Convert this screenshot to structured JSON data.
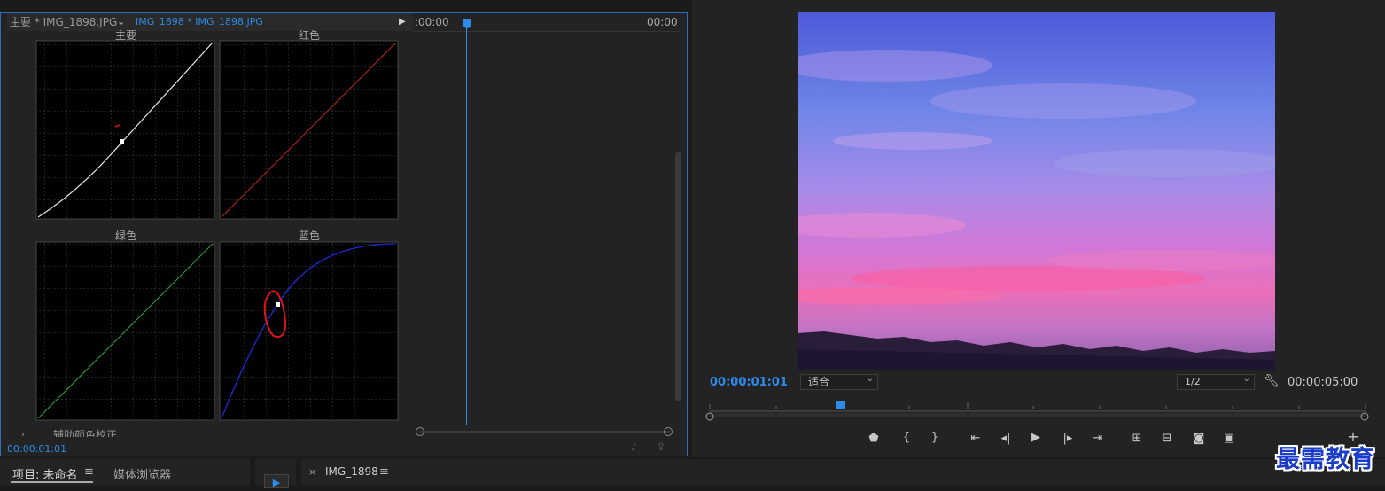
{
  "effect_controls": {
    "tab_master": "主要 * IMG_1898.JPG",
    "tab_clip": "IMG_1898 * IMG_1898.JPG",
    "timecode_start": ":00:00",
    "timecode_end": "00:00",
    "current_time": "00:00:01:01",
    "secondary_section": "辅助颜色校正",
    "curves": {
      "master": "主要",
      "red": "红色",
      "green": "绿色",
      "blue": "蓝色"
    }
  },
  "program_monitor": {
    "current_time": "00:00:01:01",
    "fit_label": "适合",
    "resolution": "1/2",
    "duration": "00:00:05:00"
  },
  "bottom": {
    "project_tab": "项目: 未命名",
    "media_browser_tab": "媒体浏览器",
    "sequence_tab": "IMG_1898"
  },
  "watermark": "最需教育",
  "colors": {
    "accent": "#2d8ceb",
    "red_curve": "#c0241c",
    "green_curve": "#2fa82f",
    "blue_curve": "#1a2bd6",
    "annotation": "#e0121b"
  },
  "icons": [
    "marker-icon",
    "mark-in-icon",
    "mark-out-icon",
    "go-to-in-icon",
    "step-back-icon",
    "play-icon",
    "step-forward-icon",
    "go-to-out-icon",
    "lift-icon",
    "extract-icon",
    "export-frame-icon",
    "comparison-view-icon",
    "add-button-icon",
    "wrench-icon",
    "menu-icon",
    "close-icon"
  ]
}
